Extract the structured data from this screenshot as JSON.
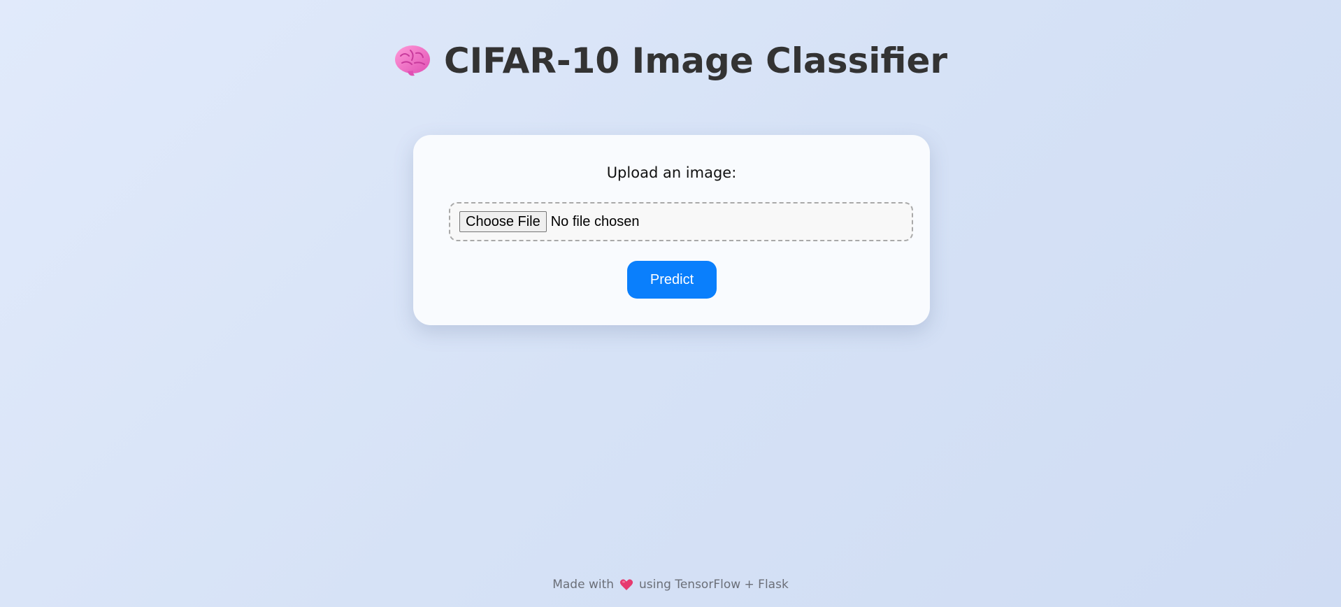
{
  "header": {
    "icon": "brain-icon",
    "title": "CIFAR-10 Image Classifier"
  },
  "upload_card": {
    "label": "Upload an image:",
    "file_input": {
      "button_label": "Choose File",
      "status": "No file chosen"
    },
    "predict_label": "Predict"
  },
  "footer": {
    "prefix": "Made with",
    "icon": "heart-icon",
    "suffix": "using TensorFlow + Flask"
  },
  "colors": {
    "accent": "#0a7ffc",
    "title": "#333333",
    "footer_text": "#6b6f78",
    "brain": "#f06ac8",
    "heart": "#e63a6f"
  }
}
